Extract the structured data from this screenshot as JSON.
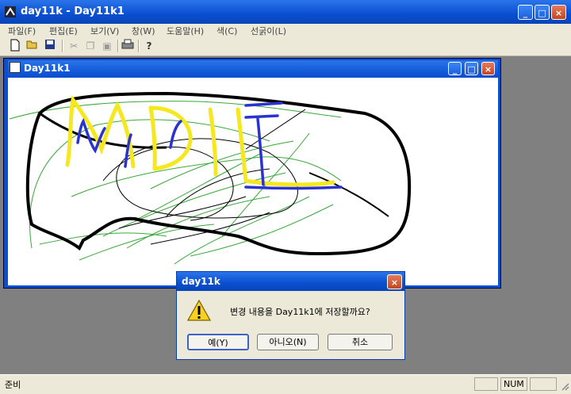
{
  "window": {
    "title": "day11k - Day11k1"
  },
  "menu": [
    "파일(F)",
    "편집(E)",
    "보기(V)",
    "창(W)",
    "도움말(H)",
    "색(C)",
    "선굵이(L)"
  ],
  "child": {
    "title": "Day11k1"
  },
  "dialog": {
    "title": "day11k",
    "message": "변경 내용을 Day11k1에 저장할까요?",
    "yes": "예(Y)",
    "no": "아니오(N)",
    "cancel": "취소"
  },
  "status": {
    "ready": "준비",
    "num": "NUM"
  },
  "colors": {
    "title_blue": "#0a4fd0",
    "face": "#ece9d8",
    "mdi_bg": "#808080"
  }
}
